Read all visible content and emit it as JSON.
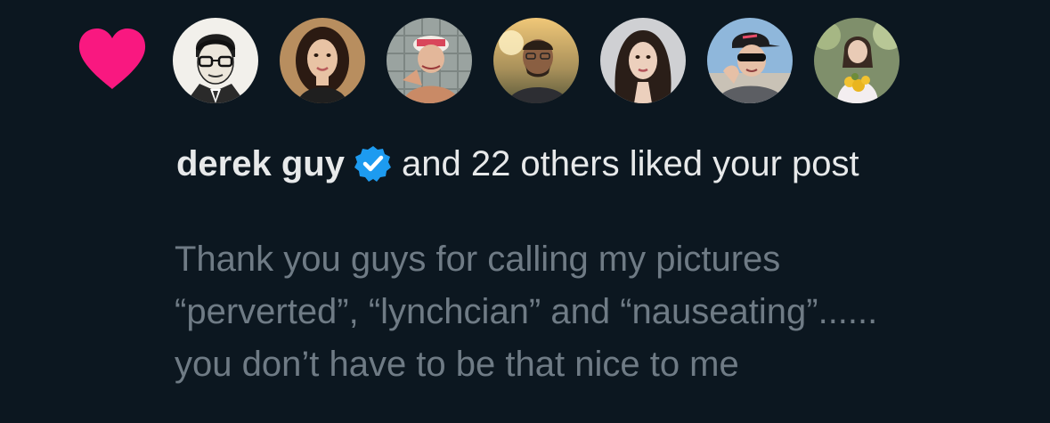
{
  "notification": {
    "type_icon": "heart-icon",
    "accent_color": "#f91880",
    "verified_color": "#1d9bf0",
    "avatars": [
      {
        "name": "avatar-illustrated-man"
      },
      {
        "name": "avatar-woman-dark-hair"
      },
      {
        "name": "avatar-person-sailor-hat"
      },
      {
        "name": "avatar-man-sunset"
      },
      {
        "name": "avatar-woman-long-hair"
      },
      {
        "name": "avatar-person-cap-sunglasses"
      },
      {
        "name": "avatar-person-flowers"
      }
    ],
    "user_name": "derek guy",
    "verified_icon": "verified-badge-icon",
    "liked_text": "and 22 others liked your post",
    "post_lines": [
      "Thank you guys for calling my pictures",
      "“perverted”, “lynchcian” and “nauseating”......",
      "you don’t have to be that nice to me"
    ]
  }
}
